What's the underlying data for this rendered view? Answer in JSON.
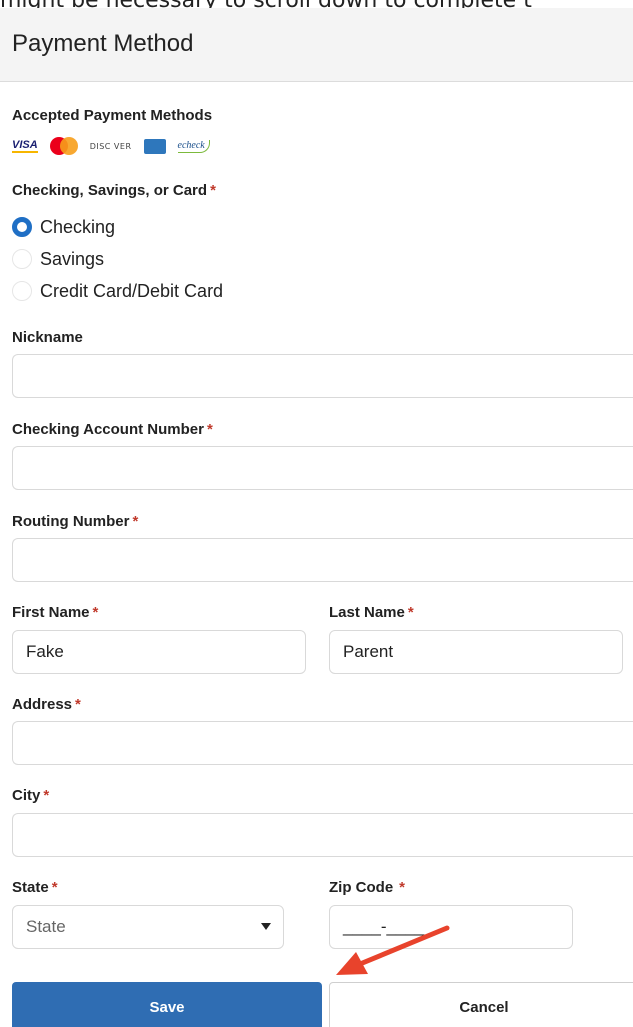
{
  "top_cut_text": "might be necessary to scroll down to complete t",
  "header": {
    "title": "Payment Method"
  },
  "accepted": {
    "label": "Accepted Payment Methods",
    "logos": {
      "visa": "VISA",
      "discover": "DISC VER",
      "echeck": "echeck"
    }
  },
  "method": {
    "label": "Checking, Savings, or Card",
    "required_mark": "*",
    "options": [
      "Checking",
      "Savings",
      "Credit Card/Debit Card"
    ],
    "selected": "Checking"
  },
  "form": {
    "nickname": {
      "label": "Nickname",
      "value": ""
    },
    "account_number": {
      "label": "Checking Account Number",
      "value": ""
    },
    "routing_number": {
      "label": "Routing Number",
      "value": ""
    },
    "first_name": {
      "label": "First Name",
      "value": "Fake"
    },
    "last_name": {
      "label": "Last Name",
      "value": "Parent"
    },
    "address": {
      "label": "Address",
      "value": ""
    },
    "city": {
      "label": "City",
      "value": ""
    },
    "state": {
      "label": "State",
      "value": "State"
    },
    "zip": {
      "label": "Zip Code",
      "value": "____-____"
    },
    "required_mark": "*"
  },
  "buttons": {
    "save": "Save",
    "cancel": "Cancel"
  },
  "colors": {
    "primary": "#2f6db3",
    "required": "#c0392b",
    "annotation_arrow": "#e8432c"
  }
}
